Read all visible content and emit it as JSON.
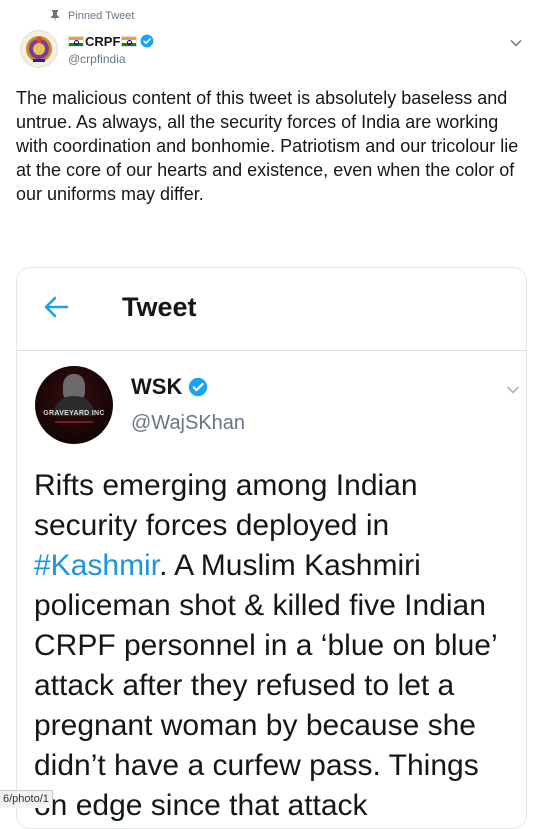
{
  "pinned": {
    "label": "Pinned Tweet"
  },
  "tweet": {
    "author_name": "CRPF",
    "handle": "@crpfindia",
    "text": "The malicious content of this tweet is absolutely baseless and untrue. As always, all the security forces of India are working with coordination and bonhomie. Patriotism and our tricolour lie at the core of our hearts and existence, even when the color of our uniforms may differ."
  },
  "screenshot_card": {
    "header_title": "Tweet",
    "author_name": "WSK",
    "handle": "@WajSKhan",
    "avatar_text": "GRAVEYARD INC",
    "text_before": "Rifts emerging among Indian security forces deployed in ",
    "hashtag": "#Kashmir",
    "text_after": ". A Muslim Kashmiri policeman shot & killed five Indian CRPF personnel in a ‘blue on blue’ attack after they refused to let a pregnant woman by because she didn’t have a curfew pass. Things on edge since that attack"
  },
  "status_bar": {
    "url": "6/photo/1"
  },
  "icons": {
    "pin": "pin-icon",
    "verified": "verified-badge-icon",
    "caret": "chevron-down-icon",
    "back": "back-arrow-icon"
  },
  "colors": {
    "accent": "#1da1f2",
    "hashtag": "#1b95e0",
    "secondary_text": "#657786"
  }
}
